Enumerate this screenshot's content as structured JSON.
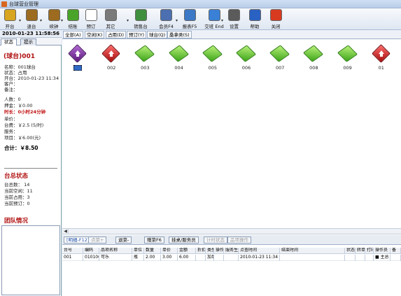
{
  "window": {
    "title": "台球营业管理"
  },
  "toolbar": {
    "items": [
      {
        "label": "开台",
        "icon": "billiard-cue-icon",
        "color": "#d8a520"
      },
      {
        "label": "退台",
        "icon": "money-bag-icon",
        "color": "#9c6b20"
      },
      {
        "label": "续钟",
        "icon": "money-bag-icon",
        "color": "#9c6b20"
      },
      {
        "label": "结账",
        "icon": "green-table-icon",
        "color": "#4aa42a"
      },
      {
        "label": "预订",
        "icon": "clock-icon",
        "color": "#ffffff"
      },
      {
        "label": "其它",
        "icon": "gear-icon",
        "color": "#7a7a7a"
      },
      {
        "label": "销售台",
        "icon": "cash-register-icon",
        "color": "#3f8f3f"
      },
      {
        "label": "会员F4",
        "icon": "member-card-icon",
        "color": "#4b6fb0"
      },
      {
        "label": "报表F5",
        "icon": "report-icon",
        "color": "#3b78c5"
      },
      {
        "label": "交班 End",
        "icon": "shift-change-icon",
        "color": "#3a80d6"
      },
      {
        "label": "设置",
        "icon": "settings-icon",
        "color": "#5b5b5b"
      },
      {
        "label": "帮助",
        "icon": "help-icon",
        "color": "#2a62c3"
      },
      {
        "label": "关闭",
        "icon": "close-icon",
        "color": "#d83a20"
      }
    ]
  },
  "left": {
    "datetime": "2010-01-23 11:58:56",
    "tabs": [
      "状态",
      "提示"
    ],
    "table_title": "(球台)001",
    "rows": [
      {
        "label": "名称：001球台"
      },
      {
        "label": "状态：占用"
      },
      {
        "label": "开台：2010-01-23 11:34"
      },
      {
        "label": "客户："
      },
      {
        "label": "备注："
      },
      {
        "label": "人数：0"
      },
      {
        "label": "押金：￥0.00"
      },
      {
        "label": "时长：0小时24分钟"
      },
      {
        "label": "单价："
      },
      {
        "label": "台费：￥2.5 (5/时)"
      },
      {
        "label": "服务："
      },
      {
        "label": "项目：￥6.00(元)"
      },
      {
        "label": "合计：￥8.50"
      }
    ],
    "summary_title": "台总状态",
    "summary": [
      {
        "label": "台总数：  14"
      },
      {
        "label": "当前空闲：11"
      },
      {
        "label": "当前占用：3"
      },
      {
        "label": "当前预订：0"
      }
    ],
    "team_title": "团队情况"
  },
  "filters": [
    "全部(A)",
    "空闲(K)",
    "占用(D)",
    "预订(Y)",
    "球台(Q)",
    "桑拿类(S)"
  ],
  "tables": [
    {
      "label": "",
      "state": "purple",
      "selected": true
    },
    {
      "label": "002",
      "state": "red"
    },
    {
      "label": "003",
      "state": "green"
    },
    {
      "label": "004",
      "state": "green"
    },
    {
      "label": "005",
      "state": "green"
    },
    {
      "label": "006",
      "state": "green"
    },
    {
      "label": "007",
      "state": "green"
    },
    {
      "label": "008",
      "state": "green"
    },
    {
      "label": "009",
      "state": "green"
    },
    {
      "label": "01",
      "state": "red"
    }
  ],
  "actions": [
    {
      "label": "[明细-F12]",
      "state": "current"
    },
    {
      "label": "点菜+",
      "state": "disabled"
    },
    {
      "label": "退菜-",
      "state": "normal"
    },
    {
      "label": "赠菜F6",
      "state": "normal"
    },
    {
      "label": "挂桌/服务员",
      "state": "normal"
    },
    {
      "label": "计时状态",
      "state": "disabled"
    },
    {
      "label": "品项操作",
      "state": "disabled"
    }
  ],
  "orders": {
    "headers": [
      "台号",
      "编码",
      "品项名称",
      "单位",
      "数量",
      "单价",
      "金额",
      "折扣",
      "类型",
      "操作",
      "服务生",
      "点查时间",
      "结束时间",
      "状态",
      "转单",
      "打印",
      "操作员",
      "备"
    ],
    "rows": [
      [
        "001",
        "010100",
        "可乐",
        "瓶",
        "2.00",
        "3.00",
        "6.00",
        "",
        "加单",
        "",
        "",
        "2010-01-23 11:34",
        "",
        "",
        "",
        "",
        "■ 主总",
        ""
      ]
    ]
  }
}
